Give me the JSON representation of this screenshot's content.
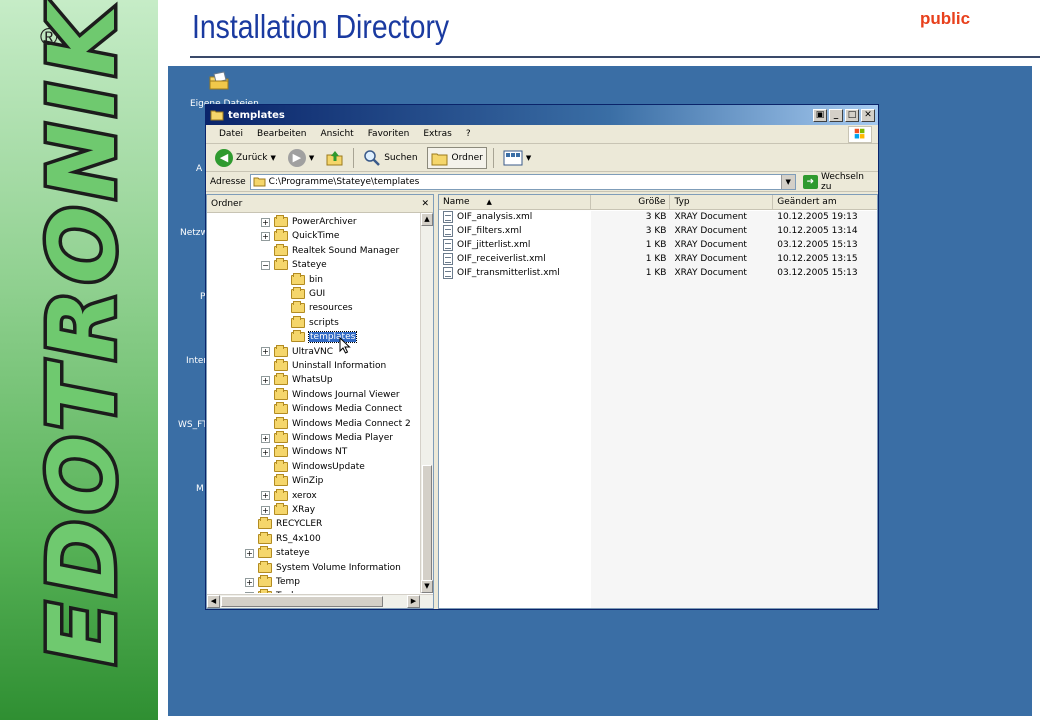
{
  "slide": {
    "title": "Installation Directory",
    "classification": "public",
    "logo_text": "EDOTRONIK",
    "registered_mark": "®",
    "colors": {
      "title": "#1a3aa0",
      "classification": "#e8401c",
      "desktop": "#3a6ea5"
    }
  },
  "desktop": {
    "labels": [
      "Eigene Dateien",
      "A",
      "Netzw",
      "P",
      "Inter",
      "WS_FT",
      "M"
    ]
  },
  "window": {
    "title": "templates",
    "caption_buttons": [
      "▣",
      "_",
      "□",
      "✕"
    ],
    "menu": [
      "Datei",
      "Bearbeiten",
      "Ansicht",
      "Favoriten",
      "Extras",
      "?"
    ],
    "toolbar": {
      "back": "Zurück",
      "search": "Suchen",
      "folders": "Ordner"
    },
    "address": {
      "label": "Adresse",
      "path": "C:\\Programme\\Stateye\\templates",
      "go": "Wechseln zu"
    },
    "tree": {
      "header": "Ordner",
      "close": "✕",
      "items": [
        {
          "label": "PowerArchiver",
          "level": 3,
          "expander": "+"
        },
        {
          "label": "QuickTime",
          "level": 3,
          "expander": "+"
        },
        {
          "label": "Realtek Sound Manager",
          "level": 3,
          "expander": ""
        },
        {
          "label": "Stateye",
          "level": 3,
          "expander": "−"
        },
        {
          "label": "bin",
          "level": 4,
          "expander": ""
        },
        {
          "label": "GUI",
          "level": 4,
          "expander": ""
        },
        {
          "label": "resources",
          "level": 4,
          "expander": ""
        },
        {
          "label": "scripts",
          "level": 4,
          "expander": ""
        },
        {
          "label": "templates",
          "level": 4,
          "expander": "",
          "selected": true
        },
        {
          "label": "UltraVNC",
          "level": 3,
          "expander": "+"
        },
        {
          "label": "Uninstall Information",
          "level": 3,
          "expander": ""
        },
        {
          "label": "WhatsUp",
          "level": 3,
          "expander": "+"
        },
        {
          "label": "Windows Journal Viewer",
          "level": 3,
          "expander": ""
        },
        {
          "label": "Windows Media Connect",
          "level": 3,
          "expander": ""
        },
        {
          "label": "Windows Media Connect 2",
          "level": 3,
          "expander": ""
        },
        {
          "label": "Windows Media Player",
          "level": 3,
          "expander": "+"
        },
        {
          "label": "Windows NT",
          "level": 3,
          "expander": "+"
        },
        {
          "label": "WindowsUpdate",
          "level": 3,
          "expander": ""
        },
        {
          "label": "WinZip",
          "level": 3,
          "expander": ""
        },
        {
          "label": "xerox",
          "level": 3,
          "expander": "+"
        },
        {
          "label": "XRay",
          "level": 3,
          "expander": "+"
        },
        {
          "label": "RECYCLER",
          "level": 2,
          "expander": ""
        },
        {
          "label": "RS_4x100",
          "level": 2,
          "expander": ""
        },
        {
          "label": "stateye",
          "level": 2,
          "expander": "+"
        },
        {
          "label": "System Volume Information",
          "level": 2,
          "expander": ""
        },
        {
          "label": "Temp",
          "level": 2,
          "expander": "+"
        },
        {
          "label": "Tools",
          "level": 2,
          "expander": "+"
        }
      ]
    },
    "files": {
      "columns": {
        "name": "Name",
        "size": "Größe",
        "type": "Typ",
        "modified": "Geändert am"
      },
      "rows": [
        {
          "name": "OIF_analysis.xml",
          "size": "3 KB",
          "type": "XRAY Document",
          "modified": "10.12.2005 19:13"
        },
        {
          "name": "OIF_filters.xml",
          "size": "3 KB",
          "type": "XRAY Document",
          "modified": "10.12.2005 13:14"
        },
        {
          "name": "OIF_jitterlist.xml",
          "size": "1 KB",
          "type": "XRAY Document",
          "modified": "03.12.2005 15:13"
        },
        {
          "name": "OIF_receiverlist.xml",
          "size": "1 KB",
          "type": "XRAY Document",
          "modified": "10.12.2005 13:15"
        },
        {
          "name": "OIF_transmitterlist.xml",
          "size": "1 KB",
          "type": "XRAY Document",
          "modified": "03.12.2005 15:13"
        }
      ]
    }
  }
}
